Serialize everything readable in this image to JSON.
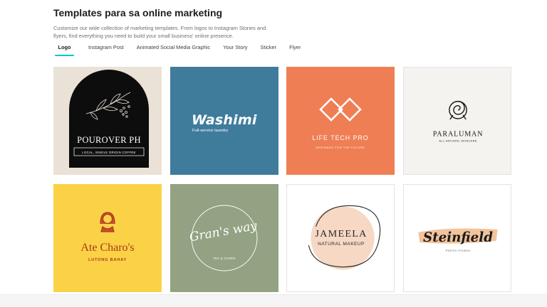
{
  "header": {
    "title": "Templates para sa online marketing",
    "description": "Customize our wide collection of marketing templates. From logos to Instagram Stories and flyers, find everything you need to build your small business' online presence."
  },
  "tabs": [
    {
      "label": "Logo",
      "active": true
    },
    {
      "label": "Instagram Post",
      "active": false
    },
    {
      "label": "Animated Social Media Graphic",
      "active": false
    },
    {
      "label": "Your Story",
      "active": false
    },
    {
      "label": "Sticker",
      "active": false
    },
    {
      "label": "Flyer",
      "active": false
    }
  ],
  "templates": [
    {
      "name": "POUROVER PH",
      "tagline": "LOCAL, SINGLE ORIGIN COFFEE",
      "bg": "#ebe2d7"
    },
    {
      "name": "Washimi",
      "tagline": "Full-service laundry",
      "bg": "#3f7c9c"
    },
    {
      "name": "LIFE TECH PRO",
      "tagline": "DESIGNED FOR THE FUTURE",
      "bg": "#ef7e54"
    },
    {
      "name": "PARALUMAN",
      "tagline": "ALL-NATURAL SKINCARE",
      "bg": "#f4f3ef"
    },
    {
      "name": "Ate Charo's",
      "tagline": "LUTONG BAHAY",
      "bg": "#fbd146"
    },
    {
      "name": "Gran's way",
      "tagline": "TEA & CAKES",
      "bg": "#93a282"
    },
    {
      "name": "JAMEELA",
      "tagline": "NATURAL MAKEUP",
      "bg": "#ffffff"
    },
    {
      "name": "Steinfield",
      "tagline": "PHOTO STUDIO",
      "bg": "#ffffff"
    }
  ],
  "colors": {
    "accent": "#00c4cc"
  }
}
